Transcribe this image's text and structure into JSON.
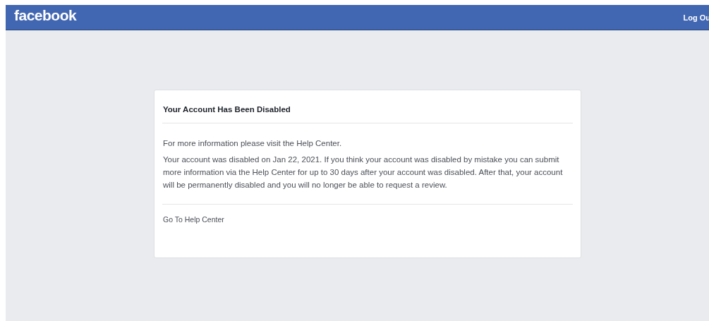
{
  "header": {
    "logo": "facebook",
    "logout": "Log Ou"
  },
  "card": {
    "title": "Your Account Has Been Disabled",
    "paragraphs": [
      "For more information please visit the Help Center.",
      "Your account was disabled on Jan 22, 2021. If you think your account was disabled by mistake you can submit more information via the Help Center for up to 30 days after your account was disabled. After that, your account will be permanently disabled and you will no longer be able to request a review."
    ],
    "link": "Go To Help Center"
  }
}
